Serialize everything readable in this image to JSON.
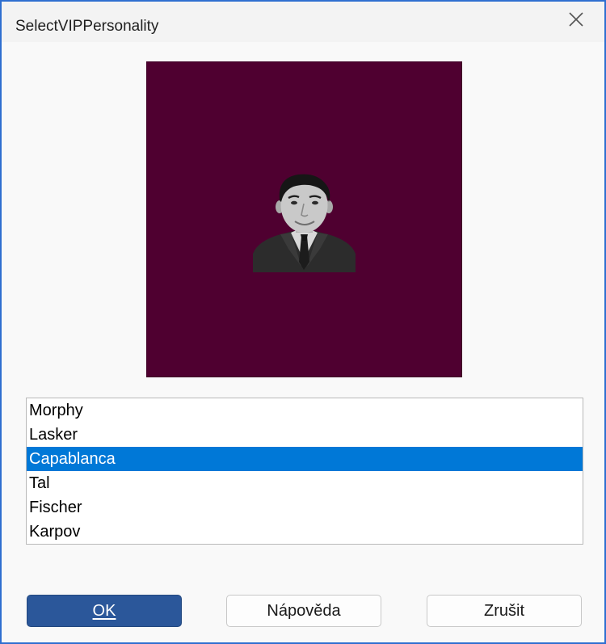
{
  "window": {
    "title": "SelectVIPPersonality"
  },
  "titlebar": {
    "close_icon": "close-icon"
  },
  "portrait": {
    "background_color": "#4f0030",
    "image": "portrait-photo"
  },
  "list": {
    "items": [
      "Morphy",
      "Lasker",
      "Capablanca",
      "Tal",
      "Fischer",
      "Karpov"
    ],
    "selected_index": 2,
    "selected_color": "#0078d7"
  },
  "buttons": {
    "ok": "OK",
    "help": "Nápověda",
    "cancel": "Zrušit"
  },
  "colors": {
    "primary_button": "#2b579a",
    "window_border": "#2f6fd0"
  }
}
